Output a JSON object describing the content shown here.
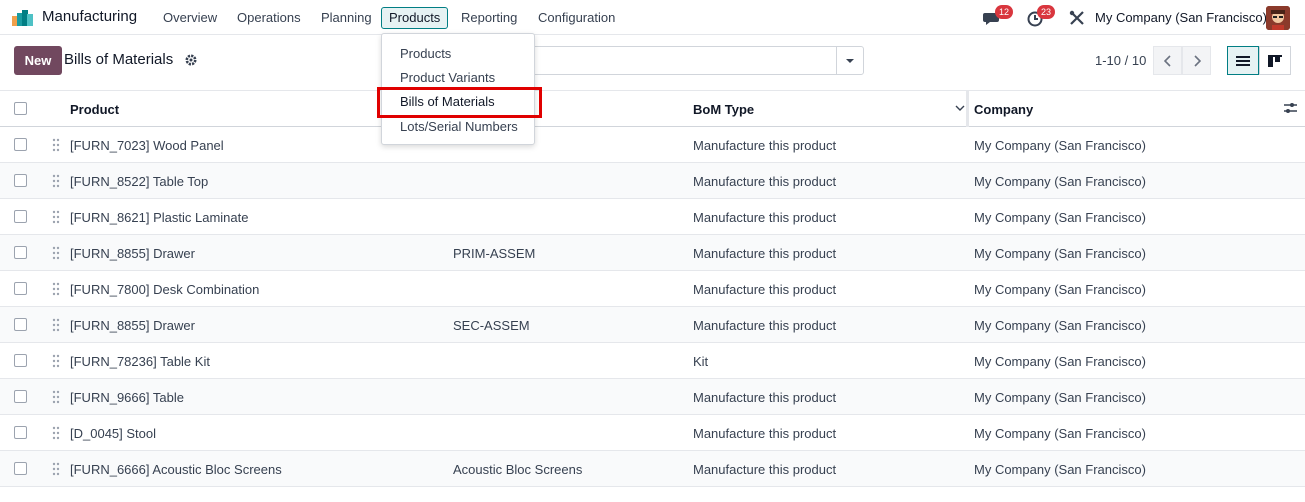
{
  "nav": {
    "app_name": "Manufacturing",
    "menu": [
      "Overview",
      "Operations",
      "Planning",
      "Products",
      "Reporting",
      "Configuration"
    ],
    "active_menu": "Products",
    "messages_badge": "12",
    "activities_badge": "23",
    "company": "My Company (San Francisco)"
  },
  "control_panel": {
    "new_label": "New",
    "title": "Bills of Materials",
    "pager": "1-10 / 10"
  },
  "dropdown": {
    "items": [
      "Products",
      "Product Variants",
      "Bills of Materials",
      "Lots/Serial Numbers"
    ],
    "highlighted": "Bills of Materials"
  },
  "table": {
    "headers": {
      "product": "Product",
      "bom_type": "BoM Type",
      "company": "Company"
    },
    "rows": [
      {
        "product": "[FURN_7023] Wood Panel",
        "reference": "",
        "bom_type": "Manufacture this product",
        "company": "My Company (San Francisco)"
      },
      {
        "product": "[FURN_8522] Table Top",
        "reference": "",
        "bom_type": "Manufacture this product",
        "company": "My Company (San Francisco)"
      },
      {
        "product": "[FURN_8621] Plastic Laminate",
        "reference": "",
        "bom_type": "Manufacture this product",
        "company": "My Company (San Francisco)"
      },
      {
        "product": "[FURN_8855] Drawer",
        "reference": "PRIM-ASSEM",
        "bom_type": "Manufacture this product",
        "company": "My Company (San Francisco)"
      },
      {
        "product": "[FURN_7800] Desk Combination",
        "reference": "",
        "bom_type": "Manufacture this product",
        "company": "My Company (San Francisco)"
      },
      {
        "product": "[FURN_8855] Drawer",
        "reference": "SEC-ASSEM",
        "bom_type": "Manufacture this product",
        "company": "My Company (San Francisco)"
      },
      {
        "product": "[FURN_78236] Table Kit",
        "reference": "",
        "bom_type": "Kit",
        "company": "My Company (San Francisco)"
      },
      {
        "product": "[FURN_9666] Table",
        "reference": "",
        "bom_type": "Manufacture this product",
        "company": "My Company (San Francisco)"
      },
      {
        "product": "[D_0045] Stool",
        "reference": "",
        "bom_type": "Manufacture this product",
        "company": "My Company (San Francisco)"
      },
      {
        "product": "[FURN_6666] Acoustic Bloc Screens",
        "reference": "Acoustic Bloc Screens",
        "bom_type": "Manufacture this product",
        "company": "My Company (San Francisco)"
      }
    ]
  },
  "colors": {
    "brand": "#71485f",
    "accent": "#017e84",
    "badge": "#d9363e",
    "highlight_box": "#e00000"
  },
  "icons": [
    "app-logo-icon",
    "chat-icon",
    "clock-icon",
    "tools-icon",
    "gear-icon",
    "chevron-down-icon",
    "chevron-left-icon",
    "chevron-right-icon",
    "list-view-icon",
    "kanban-view-icon",
    "drag-handle-icon",
    "optional-columns-icon"
  ]
}
